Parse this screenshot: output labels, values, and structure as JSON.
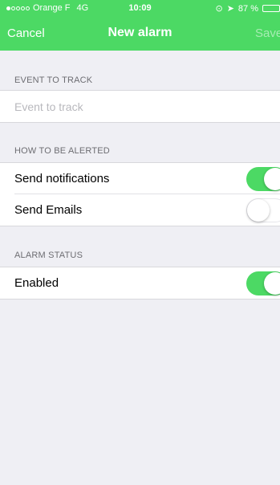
{
  "status_bar": {
    "carrier": "Orange F",
    "network": "4G",
    "time": "10:09",
    "battery": "87 %",
    "battery_level": 0.87
  },
  "nav": {
    "cancel_label": "Cancel",
    "title": "New alarm",
    "save_label": "Save"
  },
  "event_section": {
    "header": "EVENT TO TRACK",
    "input_value": "",
    "input_placeholder": "Event to track"
  },
  "alert_section": {
    "header": "HOW TO BE ALERTED",
    "items": [
      {
        "label": "Send notifications",
        "enabled": true
      },
      {
        "label": "Send Emails",
        "enabled": false
      }
    ]
  },
  "status_section": {
    "header": "ALARM STATUS",
    "items": [
      {
        "label": "Enabled",
        "enabled": true
      }
    ]
  },
  "colors": {
    "accent": "#4cd964",
    "background": "#efeff4"
  }
}
